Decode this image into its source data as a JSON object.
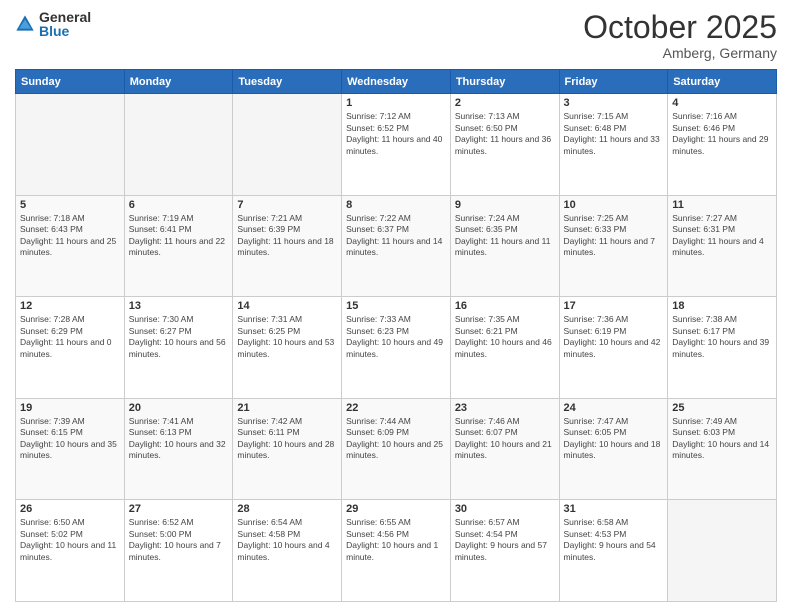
{
  "logo": {
    "general": "General",
    "blue": "Blue"
  },
  "header": {
    "month": "October 2025",
    "location": "Amberg, Germany"
  },
  "days_of_week": [
    "Sunday",
    "Monday",
    "Tuesday",
    "Wednesday",
    "Thursday",
    "Friday",
    "Saturday"
  ],
  "weeks": [
    [
      {
        "day": "",
        "empty": true
      },
      {
        "day": "",
        "empty": true
      },
      {
        "day": "",
        "empty": true
      },
      {
        "day": "1",
        "sunrise": "7:12 AM",
        "sunset": "6:52 PM",
        "daylight": "11 hours and 40 minutes."
      },
      {
        "day": "2",
        "sunrise": "7:13 AM",
        "sunset": "6:50 PM",
        "daylight": "11 hours and 36 minutes."
      },
      {
        "day": "3",
        "sunrise": "7:15 AM",
        "sunset": "6:48 PM",
        "daylight": "11 hours and 33 minutes."
      },
      {
        "day": "4",
        "sunrise": "7:16 AM",
        "sunset": "6:46 PM",
        "daylight": "11 hours and 29 minutes."
      }
    ],
    [
      {
        "day": "5",
        "sunrise": "7:18 AM",
        "sunset": "6:43 PM",
        "daylight": "11 hours and 25 minutes."
      },
      {
        "day": "6",
        "sunrise": "7:19 AM",
        "sunset": "6:41 PM",
        "daylight": "11 hours and 22 minutes."
      },
      {
        "day": "7",
        "sunrise": "7:21 AM",
        "sunset": "6:39 PM",
        "daylight": "11 hours and 18 minutes."
      },
      {
        "day": "8",
        "sunrise": "7:22 AM",
        "sunset": "6:37 PM",
        "daylight": "11 hours and 14 minutes."
      },
      {
        "day": "9",
        "sunrise": "7:24 AM",
        "sunset": "6:35 PM",
        "daylight": "11 hours and 11 minutes."
      },
      {
        "day": "10",
        "sunrise": "7:25 AM",
        "sunset": "6:33 PM",
        "daylight": "11 hours and 7 minutes."
      },
      {
        "day": "11",
        "sunrise": "7:27 AM",
        "sunset": "6:31 PM",
        "daylight": "11 hours and 4 minutes."
      }
    ],
    [
      {
        "day": "12",
        "sunrise": "7:28 AM",
        "sunset": "6:29 PM",
        "daylight": "11 hours and 0 minutes."
      },
      {
        "day": "13",
        "sunrise": "7:30 AM",
        "sunset": "6:27 PM",
        "daylight": "10 hours and 56 minutes."
      },
      {
        "day": "14",
        "sunrise": "7:31 AM",
        "sunset": "6:25 PM",
        "daylight": "10 hours and 53 minutes."
      },
      {
        "day": "15",
        "sunrise": "7:33 AM",
        "sunset": "6:23 PM",
        "daylight": "10 hours and 49 minutes."
      },
      {
        "day": "16",
        "sunrise": "7:35 AM",
        "sunset": "6:21 PM",
        "daylight": "10 hours and 46 minutes."
      },
      {
        "day": "17",
        "sunrise": "7:36 AM",
        "sunset": "6:19 PM",
        "daylight": "10 hours and 42 minutes."
      },
      {
        "day": "18",
        "sunrise": "7:38 AM",
        "sunset": "6:17 PM",
        "daylight": "10 hours and 39 minutes."
      }
    ],
    [
      {
        "day": "19",
        "sunrise": "7:39 AM",
        "sunset": "6:15 PM",
        "daylight": "10 hours and 35 minutes."
      },
      {
        "day": "20",
        "sunrise": "7:41 AM",
        "sunset": "6:13 PM",
        "daylight": "10 hours and 32 minutes."
      },
      {
        "day": "21",
        "sunrise": "7:42 AM",
        "sunset": "6:11 PM",
        "daylight": "10 hours and 28 minutes."
      },
      {
        "day": "22",
        "sunrise": "7:44 AM",
        "sunset": "6:09 PM",
        "daylight": "10 hours and 25 minutes."
      },
      {
        "day": "23",
        "sunrise": "7:46 AM",
        "sunset": "6:07 PM",
        "daylight": "10 hours and 21 minutes."
      },
      {
        "day": "24",
        "sunrise": "7:47 AM",
        "sunset": "6:05 PM",
        "daylight": "10 hours and 18 minutes."
      },
      {
        "day": "25",
        "sunrise": "7:49 AM",
        "sunset": "6:03 PM",
        "daylight": "10 hours and 14 minutes."
      }
    ],
    [
      {
        "day": "26",
        "sunrise": "6:50 AM",
        "sunset": "5:02 PM",
        "daylight": "10 hours and 11 minutes."
      },
      {
        "day": "27",
        "sunrise": "6:52 AM",
        "sunset": "5:00 PM",
        "daylight": "10 hours and 7 minutes."
      },
      {
        "day": "28",
        "sunrise": "6:54 AM",
        "sunset": "4:58 PM",
        "daylight": "10 hours and 4 minutes."
      },
      {
        "day": "29",
        "sunrise": "6:55 AM",
        "sunset": "4:56 PM",
        "daylight": "10 hours and 1 minute."
      },
      {
        "day": "30",
        "sunrise": "6:57 AM",
        "sunset": "4:54 PM",
        "daylight": "9 hours and 57 minutes."
      },
      {
        "day": "31",
        "sunrise": "6:58 AM",
        "sunset": "4:53 PM",
        "daylight": "9 hours and 54 minutes."
      },
      {
        "day": "",
        "empty": true
      }
    ]
  ]
}
